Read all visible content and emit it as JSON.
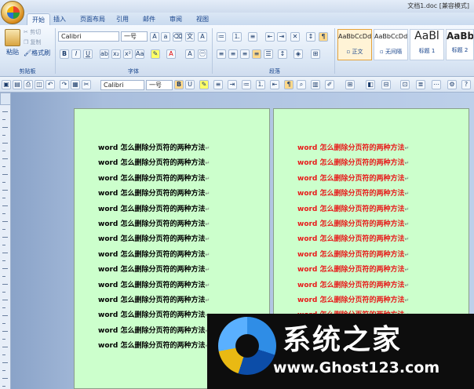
{
  "window": {
    "title": "文档1.doc [兼容模式]"
  },
  "tabs": [
    {
      "label": "开始",
      "active": true
    },
    {
      "label": "插入"
    },
    {
      "label": "页面布局"
    },
    {
      "label": "引用"
    },
    {
      "label": "邮件"
    },
    {
      "label": "审阅"
    },
    {
      "label": "视图"
    }
  ],
  "ribbon": {
    "clipboard": {
      "paste": "粘贴",
      "cut": "剪切",
      "copy": "复制",
      "format_painter": "格式刷",
      "label": "剪贴板"
    },
    "font": {
      "name": "Calibri",
      "size": "一号",
      "label": "字体"
    },
    "paragraph": {
      "label": "段落"
    },
    "styles": [
      {
        "sample": "AaBbCcDd",
        "name": "▫ 正文"
      },
      {
        "sample": "AaBbCcDd",
        "name": "▫ 无间隔"
      },
      {
        "sample": "AaBl",
        "name": "标题 1"
      },
      {
        "sample": "AaBb",
        "name": "标题 2"
      }
    ]
  },
  "quickbar": {
    "font": "Calibri",
    "size": "一号"
  },
  "document": {
    "line_text": "word 怎么删除分页符的两种方法",
    "paragraph_mark": "↵",
    "left_page_color": "#000000",
    "right_page_color": "#e81a1a",
    "page_bg": "#ccffcc"
  },
  "watermark": {
    "title": "系统之家",
    "url": "www.Ghost123.com"
  }
}
